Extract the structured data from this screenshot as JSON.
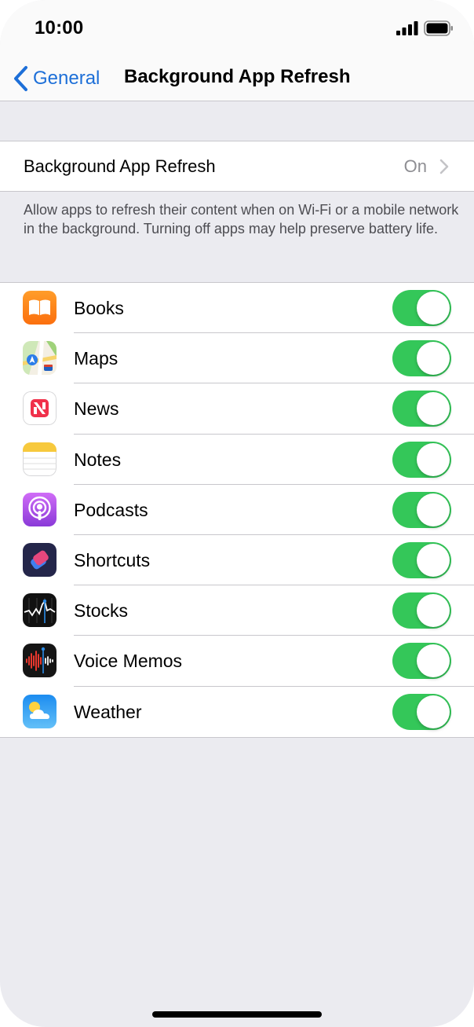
{
  "status_bar": {
    "time": "10:00"
  },
  "nav": {
    "back_label": "General",
    "title": "Background App Refresh"
  },
  "setting": {
    "label": "Background App Refresh",
    "value": "On"
  },
  "footer": "Allow apps to refresh their content when on Wi-Fi or a mobile network in the background. Turning off apps may help preserve battery life.",
  "apps": [
    {
      "name": "Books",
      "icon": "books-icon",
      "on": true
    },
    {
      "name": "Maps",
      "icon": "maps-icon",
      "on": true
    },
    {
      "name": "News",
      "icon": "news-icon",
      "on": true
    },
    {
      "name": "Notes",
      "icon": "notes-icon",
      "on": true
    },
    {
      "name": "Podcasts",
      "icon": "podcasts-icon",
      "on": true
    },
    {
      "name": "Shortcuts",
      "icon": "shortcuts-icon",
      "on": true
    },
    {
      "name": "Stocks",
      "icon": "stocks-icon",
      "on": true
    },
    {
      "name": "Voice Memos",
      "icon": "voice-memos-icon",
      "on": true
    },
    {
      "name": "Weather",
      "icon": "weather-icon",
      "on": true
    }
  ],
  "colors": {
    "accent": "#1d6fd8",
    "toggle_on": "#34c759",
    "background": "#ebebf0"
  }
}
